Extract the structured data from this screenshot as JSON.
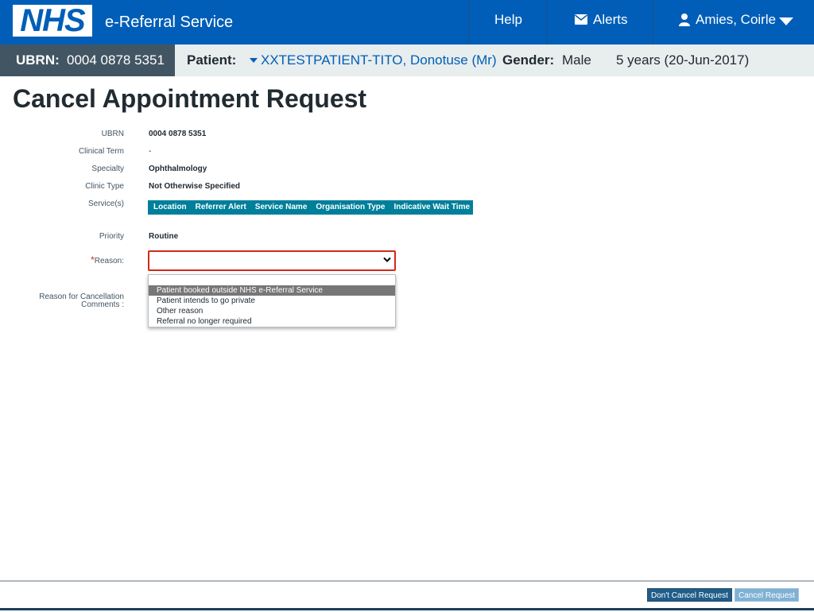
{
  "header": {
    "logo_text": "NHS",
    "service_name": "e-Referral Service",
    "nav": {
      "help": "Help",
      "alerts": "Alerts",
      "user": "Amies, Coirle"
    }
  },
  "patient_bar": {
    "ubrn_label": "UBRN:",
    "ubrn_value": "0004 0878 5351",
    "patient_label": "Patient:",
    "patient_name": "XXTESTPATIENT-TITO, Donotuse (Mr)",
    "gender_label": "Gender:",
    "gender_value": "Male",
    "age": "5 years (20-Jun-2017)"
  },
  "page": {
    "title": "Cancel Appointment Request"
  },
  "details": {
    "ubrn_label": "UBRN",
    "ubrn_value": "0004 0878 5351",
    "clinical_term_label": "Clinical Term",
    "clinical_term_value": "-",
    "specialty_label": "Specialty",
    "specialty_value": "Ophthalmology",
    "clinic_type_label": "Clinic Type",
    "clinic_type_value": "Not Otherwise Specified",
    "services_label": "Service(s)",
    "services_columns": [
      "Location",
      "Referrer Alert",
      "Service Name",
      "Organisation Type",
      "Indicative Wait Time"
    ],
    "priority_label": "Priority",
    "priority_value": "Routine"
  },
  "form": {
    "required_mark": "*",
    "reason_label": "Reason:",
    "reason_value": "",
    "reason_options": [
      "",
      "Patient booked outside NHS e-Referral Service",
      "Patient intends to go private",
      "Other reason",
      "Referral no longer required"
    ],
    "highlighted_option": "Patient booked outside NHS e-Referral Service",
    "comments_label_line1": "Reason for Cancellation",
    "comments_label_line2": "Comments :"
  },
  "footer": {
    "dont_cancel_label": "Don't Cancel Request",
    "cancel_label": "Cancel Request"
  },
  "colors": {
    "nhs_blue": "#005eb8",
    "error_red": "#d5281b",
    "table_header": "#007f9b",
    "ubrn_bg": "#425563"
  },
  "icons": [
    "envelope-icon",
    "user-icon",
    "chevron-down-icon",
    "caret-down-icon"
  ]
}
